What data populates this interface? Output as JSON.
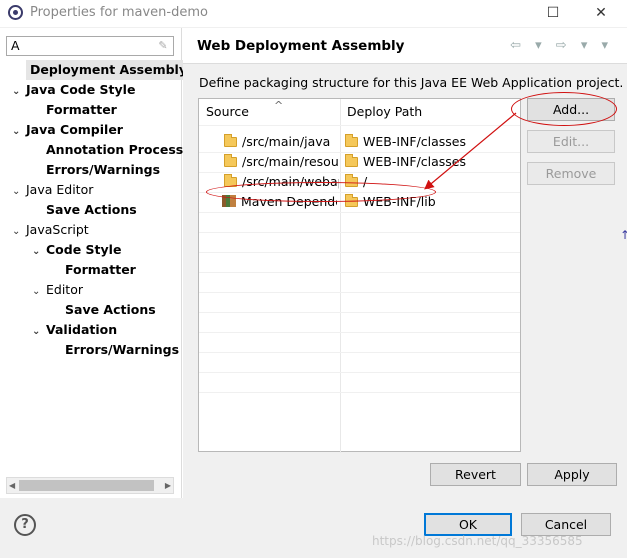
{
  "window": {
    "title": "Properties for maven-demo",
    "minimize": "—",
    "maximize": "☐",
    "close": "✕"
  },
  "filter": {
    "value": "A",
    "clear_icon": "eraser-icon"
  },
  "tree": [
    {
      "label": "Deployment Assembly",
      "arrow": "",
      "bold": true,
      "selected": true
    },
    {
      "label": "Java Code Style",
      "arrow": "⌄",
      "bold": true
    },
    {
      "label": "Formatter",
      "arrow": "",
      "bold": true
    },
    {
      "label": "Java Compiler",
      "arrow": "⌄",
      "bold": true
    },
    {
      "label": "Annotation Processi",
      "arrow": "",
      "bold": true
    },
    {
      "label": "Errors/Warnings",
      "arrow": "",
      "bold": true
    },
    {
      "label": "Java Editor",
      "arrow": "⌄",
      "bold": false
    },
    {
      "label": "Save Actions",
      "arrow": "",
      "bold": true
    },
    {
      "label": "JavaScript",
      "arrow": "⌄",
      "bold": false
    },
    {
      "label": "Code Style",
      "arrow": "⌄",
      "bold": true
    },
    {
      "label": "Formatter",
      "arrow": "",
      "bold": true
    },
    {
      "label": "Editor",
      "arrow": "⌄",
      "bold": false
    },
    {
      "label": "Save Actions",
      "arrow": "",
      "bold": true
    },
    {
      "label": "Validation",
      "arrow": "⌄",
      "bold": true
    },
    {
      "label": "Errors/Warnings",
      "arrow": "",
      "bold": true
    }
  ],
  "page": {
    "title": "Web Deployment Assembly",
    "nav": "⇦ ▾ ⇨ ▾ ▾",
    "description": "Define packaging structure for this Java EE Web Application project."
  },
  "table": {
    "columns": [
      "Source",
      "Deploy Path"
    ],
    "rows": [
      {
        "source": "/src/main/java",
        "path": "WEB-INF/classes",
        "icon": "folder-icon"
      },
      {
        "source": "/src/main/resour",
        "path": "WEB-INF/classes",
        "icon": "folder-icon"
      },
      {
        "source": "/src/main/webap",
        "path": "/",
        "icon": "folder-icon"
      },
      {
        "source": "Maven Depende",
        "path": "WEB-INF/lib",
        "icon": "library-icon"
      }
    ]
  },
  "buttons": {
    "add": "Add...",
    "edit": "Edit...",
    "remove": "Remove",
    "revert": "Revert",
    "apply": "Apply",
    "ok": "OK",
    "cancel": "Cancel"
  },
  "help": "?",
  "watermark": "https://blog.csdn.net/qq_33356585",
  "annotation_color": "#d01010",
  "selection_color": "#0078d7"
}
